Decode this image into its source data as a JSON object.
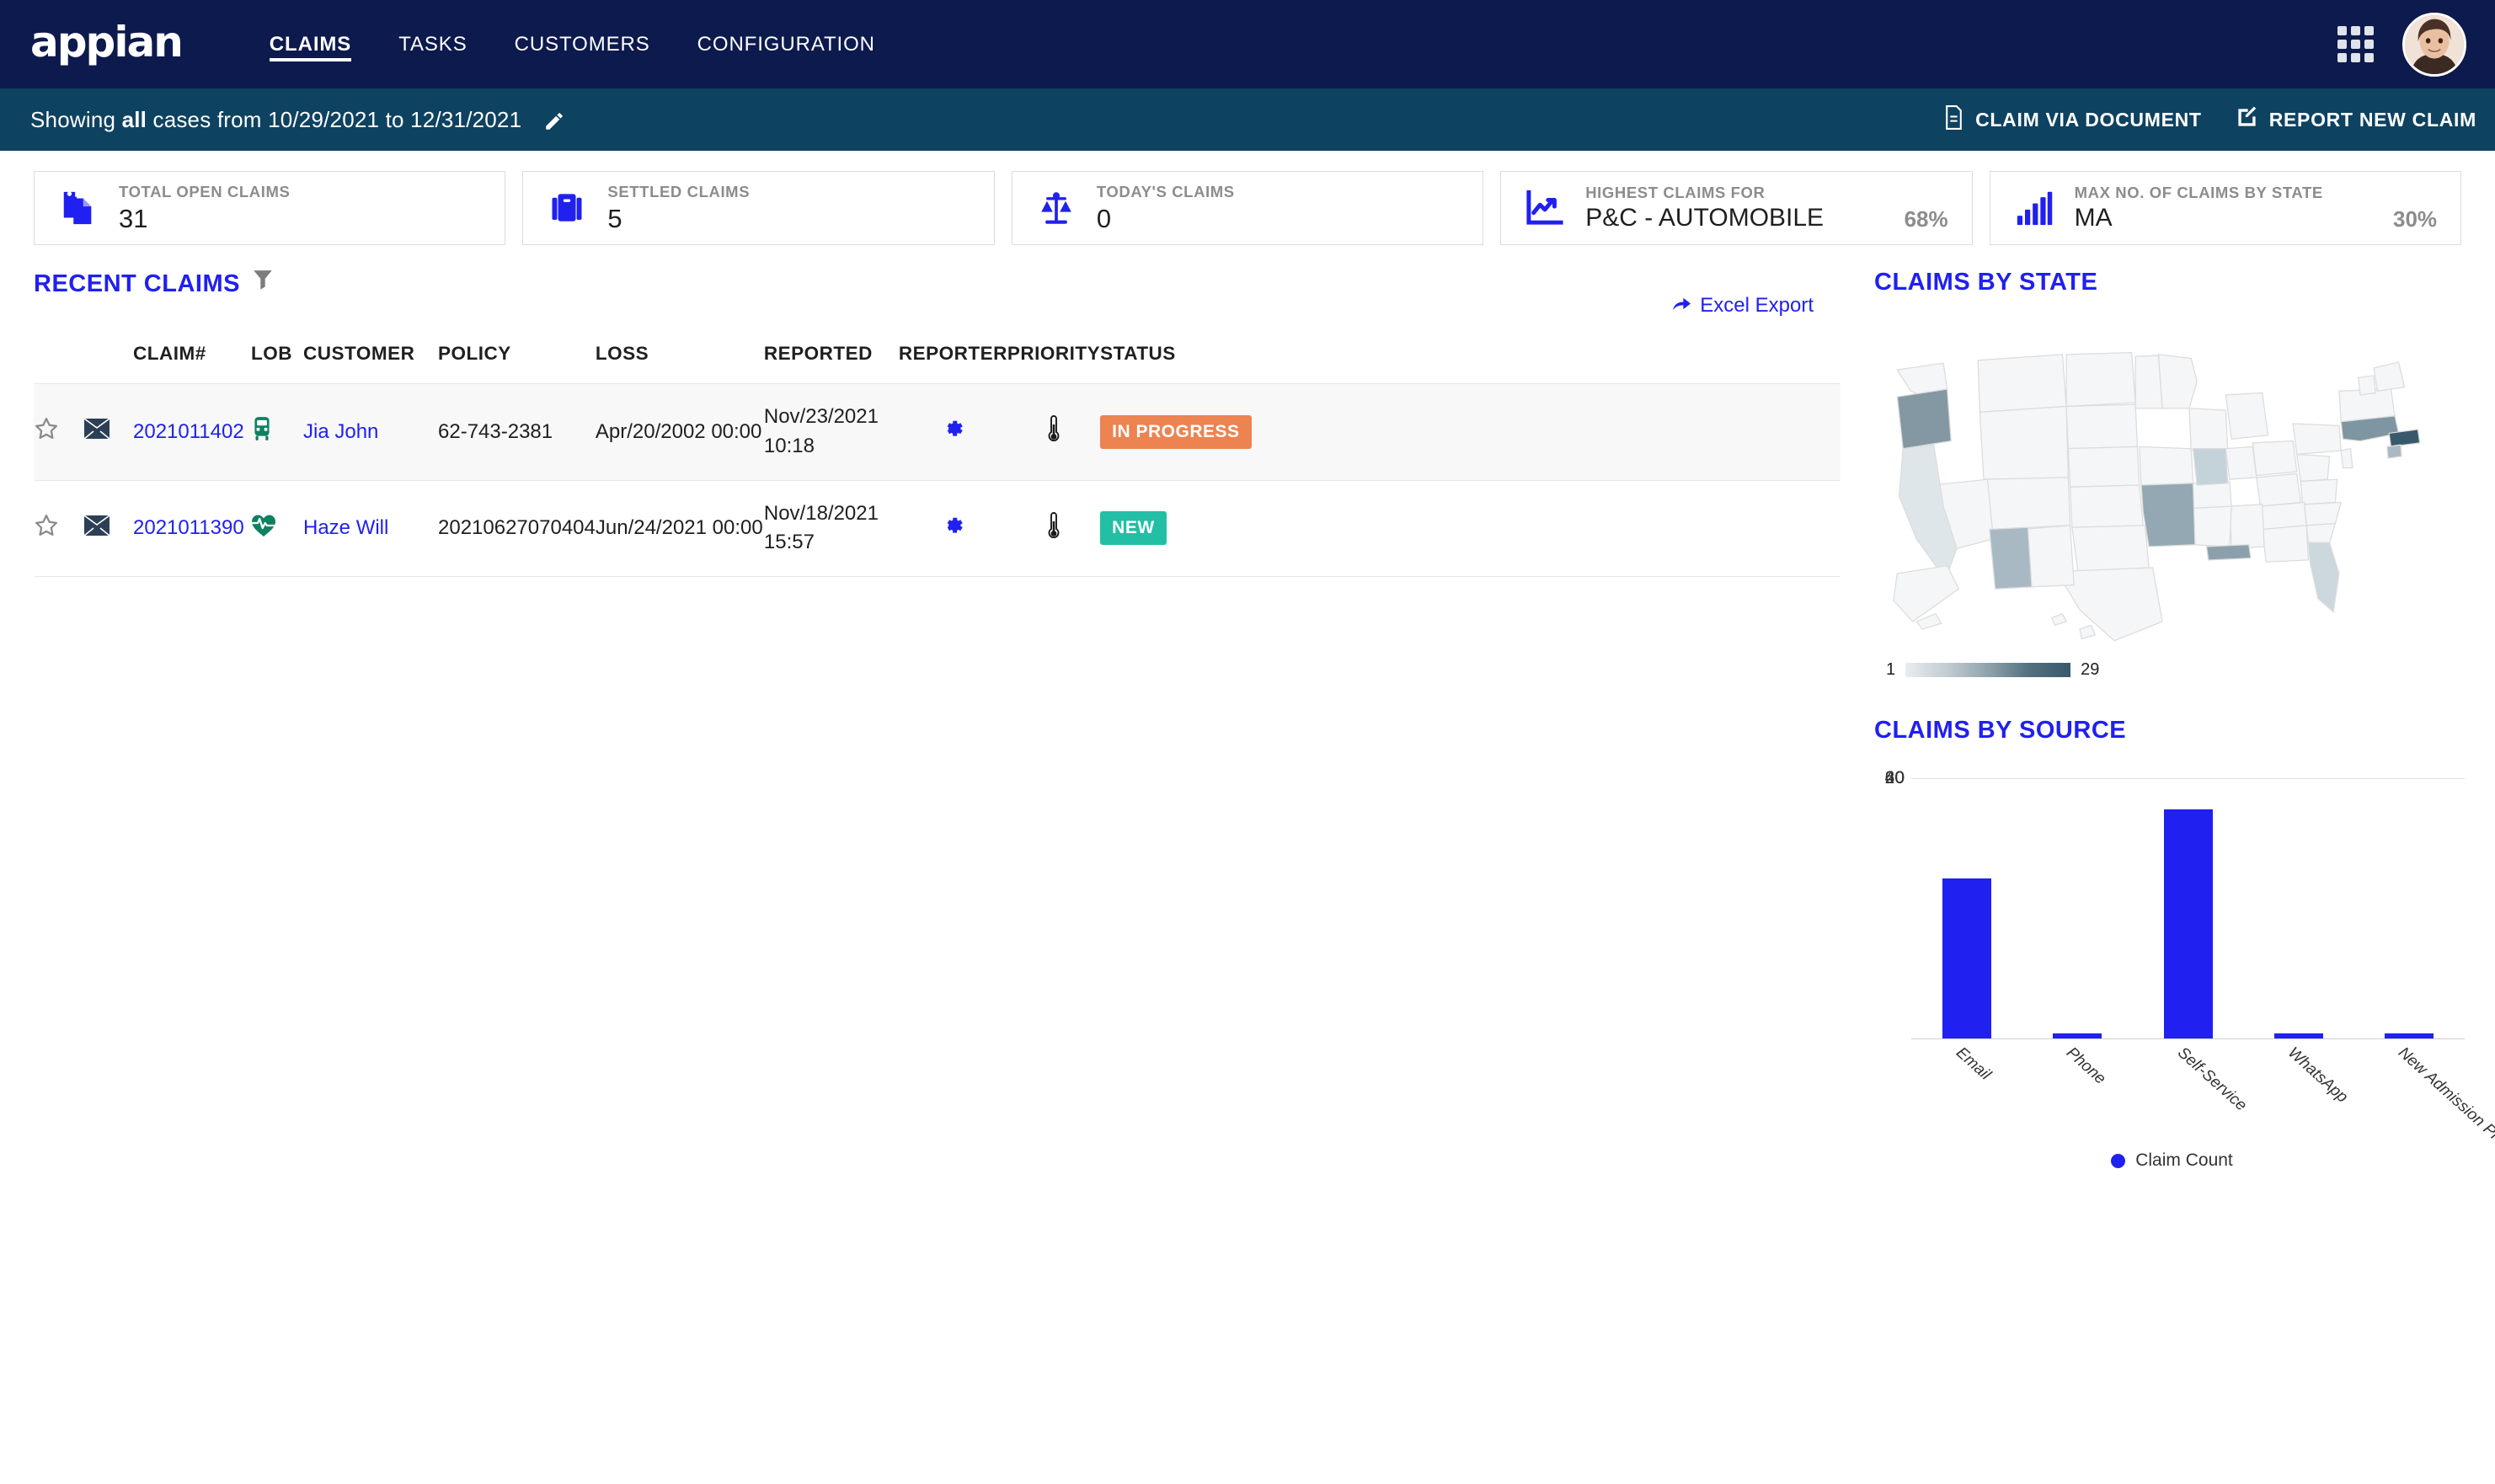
{
  "header": {
    "logo": "appian",
    "nav": [
      {
        "label": "CLAIMS",
        "active": true
      },
      {
        "label": "TASKS",
        "active": false
      },
      {
        "label": "CUSTOMERS",
        "active": false
      },
      {
        "label": "CONFIGURATION",
        "active": false
      }
    ],
    "grid_icon": "apps-grid-icon",
    "avatar": "user-avatar"
  },
  "subbar": {
    "prefix": "Showing ",
    "emphasis": "all",
    "suffix": " cases from 10/29/2021 to 12/31/2021",
    "edit_icon": "pencil-icon",
    "actions": [
      {
        "label": "CLAIM VIA DOCUMENT",
        "icon": "document-icon"
      },
      {
        "label": "REPORT NEW CLAIM",
        "icon": "edit-square-icon"
      }
    ]
  },
  "kpis": [
    {
      "label": "TOTAL OPEN CLAIMS",
      "value": "31",
      "pct": "",
      "icon": "clipboard-copy-icon"
    },
    {
      "label": "SETTLED CLAIMS",
      "value": "5",
      "pct": "",
      "icon": "briefcase-icon"
    },
    {
      "label": "TODAY'S CLAIMS",
      "value": "0",
      "pct": "",
      "icon": "scales-icon"
    },
    {
      "label": "HIGHEST CLAIMS FOR",
      "value": "P&C - AUTOMOBILE",
      "pct": "68%",
      "icon": "trend-chart-icon"
    },
    {
      "label": "MAX NO. OF CLAIMS BY STATE",
      "value": "MA",
      "pct": "30%",
      "icon": "bar-chart-icon"
    }
  ],
  "recent_claims": {
    "title": "RECENT CLAIMS",
    "filter_icon": "funnel-filter-icon",
    "excel_export": "Excel Export",
    "excel_icon": "share-arrow-icon",
    "columns": [
      "",
      "",
      "CLAIM#",
      "LOB",
      "CUSTOMER",
      "POLICY",
      "LOSS",
      "REPORTED",
      "REPORTER",
      "PRIORITY",
      "STATUS"
    ],
    "rows": [
      {
        "star": "star-outline-icon",
        "mail": "envelope-icon",
        "claim": "2021011402",
        "lob_icon": "bus-vehicle-icon",
        "lob_color": "#0d8060",
        "customer": "Jia John",
        "policy": "62-743-2381",
        "loss": "Apr/20/2002 00:00",
        "reported_date": "Nov/23/2021",
        "reported_time": "10:18",
        "reporter_icon": "gear-icon",
        "priority_icon": "thermometer-icon",
        "status": "IN PROGRESS",
        "status_color": "#ec8351"
      },
      {
        "star": "star-outline-icon",
        "mail": "envelope-icon",
        "claim": "2021011390",
        "lob_icon": "heartbeat-health-icon",
        "lob_color": "#0d8060",
        "customer": "Haze Will",
        "policy": "20210627070404",
        "loss": "Jun/24/2021 00:00",
        "reported_date": "Nov/18/2021",
        "reported_time": "15:57",
        "reporter_icon": "gear-icon",
        "priority_icon": "thermometer-icon",
        "status": "NEW",
        "status_color": "#22bfa5"
      }
    ]
  },
  "claims_by_state": {
    "title": "CLAIMS BY STATE",
    "legend_min": "1",
    "legend_max": "29",
    "states": [
      {
        "code": "MA",
        "value": 29
      },
      {
        "code": "OR",
        "value": 20
      },
      {
        "code": "NY",
        "value": 14
      },
      {
        "code": "AZ",
        "value": 9
      },
      {
        "code": "MO",
        "value": 9
      },
      {
        "code": "LA",
        "value": 9
      },
      {
        "code": "IL",
        "value": 5
      },
      {
        "code": "FL",
        "value": 5
      },
      {
        "code": "CA",
        "value": 3
      },
      {
        "code": "CT",
        "value": 5
      }
    ]
  },
  "chart_data": {
    "type": "bar",
    "title": "CLAIMS BY SOURCE",
    "categories": [
      "Email",
      "Phone",
      "Self-Service",
      "WhatsApp",
      "New Admission Process"
    ],
    "values": [
      37,
      1,
      53,
      1,
      1
    ],
    "series": [
      {
        "name": "Claim Count",
        "values": [
          37,
          1,
          53,
          1,
          1
        ]
      }
    ],
    "xlabel": "",
    "ylabel": "",
    "ylim": [
      0,
      60
    ],
    "yticks": [
      0,
      20,
      40,
      60
    ],
    "grid": true,
    "legend_position": "bottom",
    "legend_entries": [
      "Claim Count"
    ],
    "bar_color": "#2020f0"
  }
}
